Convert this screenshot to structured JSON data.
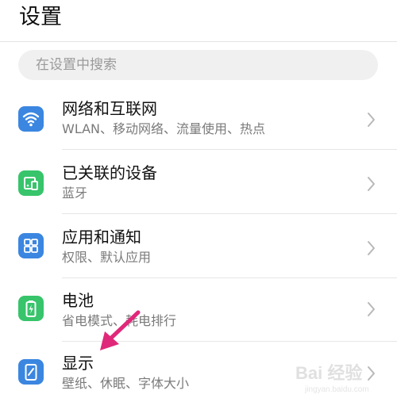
{
  "header": {
    "title": "设置"
  },
  "search": {
    "placeholder": "在设置中搜索"
  },
  "items": [
    {
      "title": "网络和互联网",
      "subtitle": "WLAN、移动网络、流量使用、热点",
      "icon": "wifi-icon",
      "color": "#3b86e0"
    },
    {
      "title": "已关联的设备",
      "subtitle": "蓝牙",
      "icon": "devices-icon",
      "color": "#37c46b"
    },
    {
      "title": "应用和通知",
      "subtitle": "权限、默认应用",
      "icon": "apps-icon",
      "color": "#3b86e0"
    },
    {
      "title": "电池",
      "subtitle": "省电模式、耗电排行",
      "icon": "battery-icon",
      "color": "#37c46b"
    },
    {
      "title": "显示",
      "subtitle": "壁纸、休眠、字体大小",
      "icon": "display-icon",
      "color": "#3b86e0"
    }
  ],
  "annotation": {
    "arrow_color": "#e0287a"
  },
  "watermark": {
    "text": "Bai 经验",
    "subtext": "jingyan.baidu.com"
  }
}
